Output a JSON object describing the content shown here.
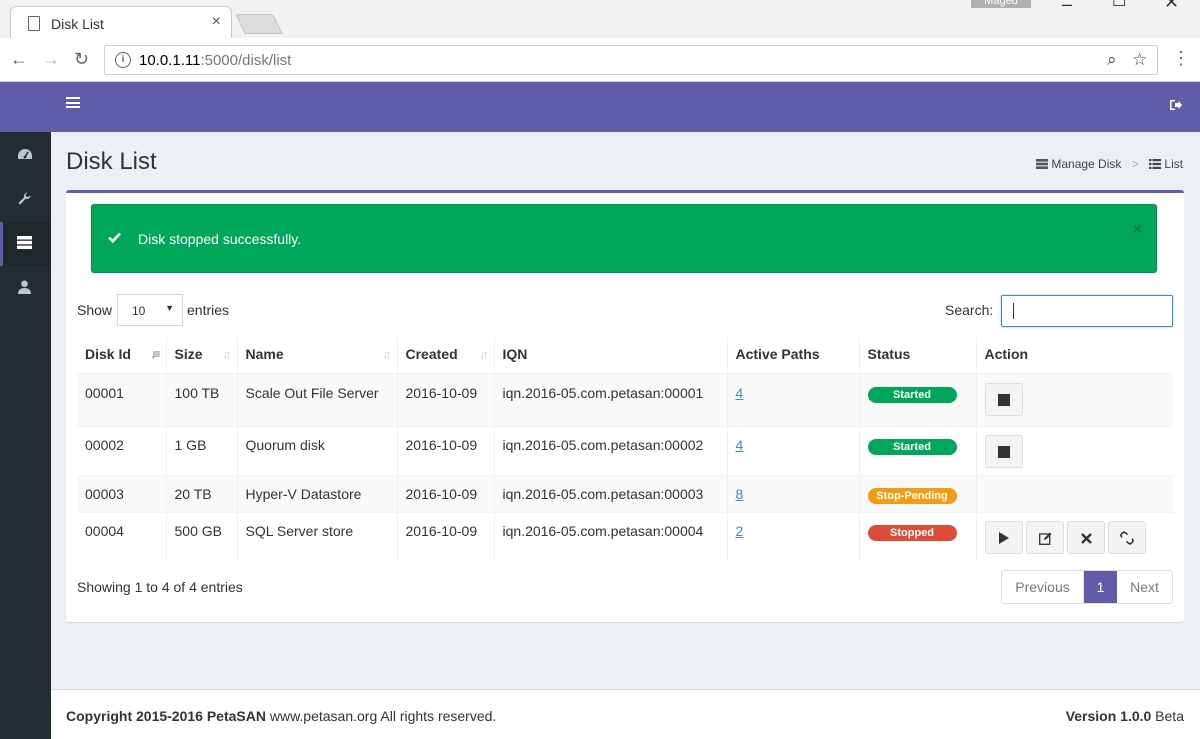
{
  "browser": {
    "tab_title": "Disk List",
    "tab_close": "×",
    "user_chip": "Maged",
    "url_host": "10.0.1.11",
    "url_rest": ":5000/disk/list"
  },
  "page": {
    "title": "Disk List",
    "breadcrumb": [
      "Manage Disk",
      "List"
    ]
  },
  "alert": {
    "message": "Disk stopped successfully.",
    "close": "×"
  },
  "controls": {
    "show_label": "Show",
    "entries_value": "10",
    "entries_label": "entries",
    "search_label": "Search:"
  },
  "table": {
    "headers": [
      "Disk Id",
      "Size",
      "Name",
      "Created",
      "IQN",
      "Active Paths",
      "Status",
      "Action"
    ],
    "rows": [
      {
        "id": "00001",
        "size": "100 TB",
        "name": "Scale Out File Server",
        "created": "2016-10-09",
        "iqn": "iqn.2016-05.com.petasan:00001",
        "paths": "4",
        "status": "Started",
        "status_color": "#00a65a"
      },
      {
        "id": "00002",
        "size": "1 GB",
        "name": "Quorum disk",
        "created": "2016-10-09",
        "iqn": "iqn.2016-05.com.petasan:00002",
        "paths": "4",
        "status": "Started",
        "status_color": "#00a65a"
      },
      {
        "id": "00003",
        "size": "20 TB",
        "name": "Hyper-V Datastore",
        "created": "2016-10-09",
        "iqn": "iqn.2016-05.com.petasan:00003",
        "paths": "8",
        "status": "Stop-Pending",
        "status_color": "#f39c12"
      },
      {
        "id": "00004",
        "size": "500 GB",
        "name": "SQL Server store",
        "created": "2016-10-09",
        "iqn": "iqn.2016-05.com.petasan:00004",
        "paths": "2",
        "status": "Stopped",
        "status_color": "#dd4b39"
      }
    ]
  },
  "pagination": {
    "info": "Showing 1 to 4 of 4 entries",
    "previous": "Previous",
    "current": "1",
    "next": "Next"
  },
  "footer": {
    "copyright_bold": "Copyright 2015-2016 PetaSAN",
    "copyright_rest": " www.petasan.org All rights reserved.",
    "version_bold": "Version 1.0.0",
    "version_rest": " Beta"
  },
  "colors": {
    "brand": "#605ca8",
    "sidebar": "#222d32",
    "success": "#00a65a"
  }
}
